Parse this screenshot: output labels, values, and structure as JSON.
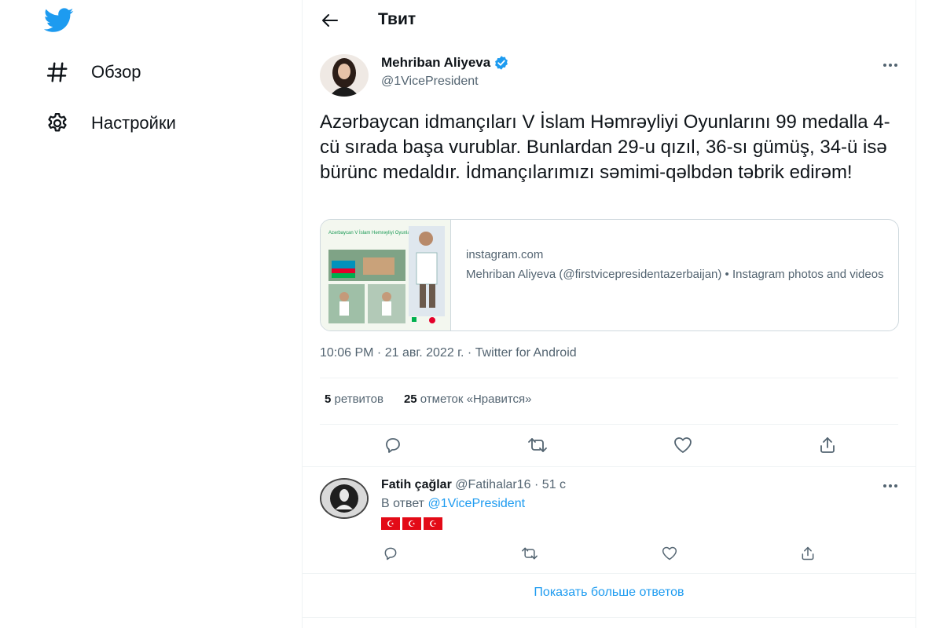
{
  "nav": {
    "logo_icon": "twitter-bird-icon",
    "items": [
      {
        "label": "Обзор",
        "icon": "hashtag-icon"
      },
      {
        "label": "Настройки",
        "icon": "gear-icon"
      }
    ]
  },
  "header": {
    "title": "Твит",
    "back_icon": "arrow-left-icon"
  },
  "tweet": {
    "author_name": "Mehriban Aliyeva",
    "author_handle": "@1VicePresident",
    "text": "Azərbaycan idmançıları V İslam Həmrəyliyi Oyunlarını 99 medalla 4-cü sırada başa vurublar. Bunlardan 29-u qızıl, 36-sı gümüş, 34-ü isə bürünc medaldır. İdmançılarımızı səmimi-qəlbdən təbrik edirəm!",
    "card": {
      "domain": "instagram.com",
      "description": "Mehriban Aliyeva (@firstvicepresidentazerbaijan) • Instagram photos and videos",
      "image_caption": "Azərbaycan V İslam Həmrəyliyi Oyunlarda"
    },
    "timestamp": "10:06 PM · 21 авг. 2022 г. · Twitter for Android",
    "stats": {
      "retweets_count": "5",
      "retweets_label": "ретвитов",
      "likes_count": "25",
      "likes_label": "отметок «Нравится»"
    }
  },
  "reply": {
    "name": "Fatih çağlar",
    "handle": "@Fatihalar16",
    "time": "· 51 с",
    "reply_to_label": "В ответ",
    "reply_to_handle": "@1VicePresident",
    "flags": [
      "☪",
      "☪",
      "☪"
    ]
  },
  "show_more": "Показать больше ответов",
  "colors": {
    "accent": "#1d9bf0",
    "text": "#0f1419",
    "muted": "#536471",
    "border": "#cfd9de",
    "flag": "#e30a17"
  }
}
